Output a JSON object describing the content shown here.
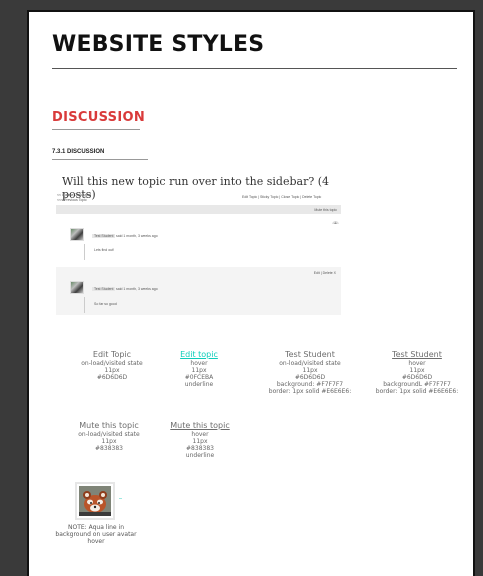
{
  "page": {
    "title": "WEBSITE STYLES",
    "section_title": "DISCUSSION",
    "subsection_title": "7.3.1 DISCUSSION"
  },
  "thread": {
    "title": "Will this new topic run over into the sidebar? (4 posts)",
    "breadcrumb": "<< Course Discussion",
    "prev_topic": "<<< Previous Topic",
    "topic_links": "Edit Topic | Sticky Topic | Close Topic | Delete Topic",
    "mute_link": "Mute this topic",
    "post1": {
      "author": "Test Student",
      "meta": "said 1 month, 3 weeks ago",
      "content": "Lets find out!"
    },
    "post2": {
      "actions": "Edit | Delete X",
      "author": "Test Student",
      "meta": "said 1 month, 3 weeks ago",
      "content": "So far so good"
    }
  },
  "styles": [
    {
      "label": "Edit Topic",
      "lines": [
        "on-load/visited state",
        "11px",
        "#6D6D6D"
      ]
    },
    {
      "label": "Edit topic",
      "lines": [
        "hover",
        "11px",
        "#0FCEBA",
        "underline"
      ]
    },
    {
      "label": "Test Student",
      "lines": [
        "on-load/visited state",
        "11px",
        "#6D6D6D",
        "background: #F7F7F7",
        "border: 1px solid #E6E6E6:"
      ]
    },
    {
      "label": "Test Student",
      "lines": [
        "hover",
        "11px",
        "#6D6D6D",
        "backgroundL #F7F7F7",
        "border: 1px solid #E6E6E6:"
      ]
    },
    {
      "label": "Mute this topic",
      "lines": [
        "on-load/visited state",
        "11px",
        "#838383"
      ]
    },
    {
      "label": "Mute this topic",
      "lines": [
        "hover",
        "11px",
        "#838383",
        "underline"
      ]
    }
  ],
  "note": "NOTE: Aqua line in background on user avatar hover",
  "colors": {
    "accent_red": "#d93a3a",
    "teal": "#0fceba",
    "text_gray": "#6d6d6d"
  }
}
